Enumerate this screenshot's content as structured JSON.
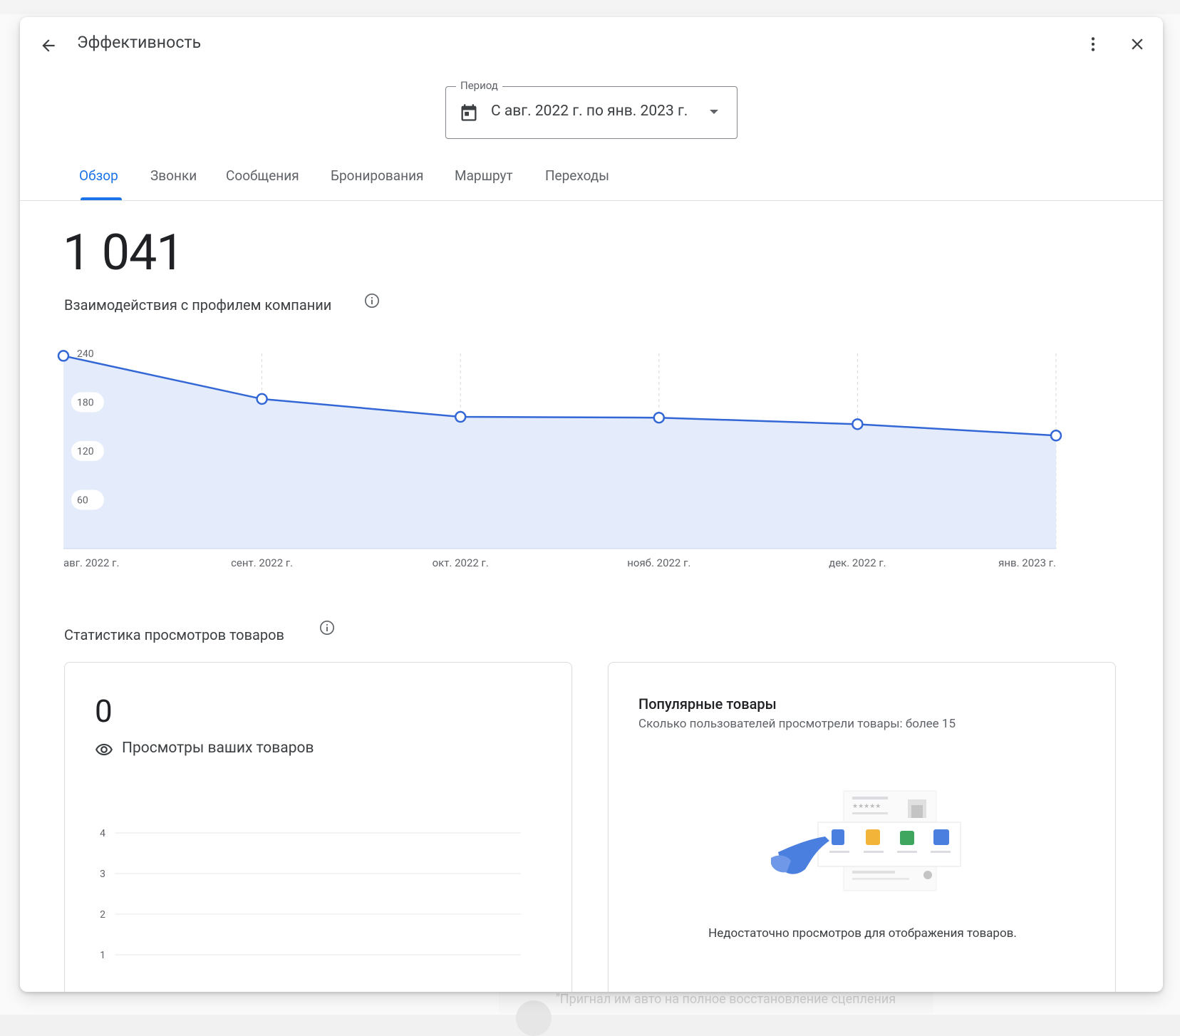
{
  "dialog": {
    "title": "Эффективность"
  },
  "period": {
    "label": "Период",
    "value": "С авг. 2022 г. по янв. 2023 г."
  },
  "tabs": [
    {
      "label": "Обзор",
      "active": true
    },
    {
      "label": "Звонки",
      "active": false
    },
    {
      "label": "Сообщения",
      "active": false
    },
    {
      "label": "Бронирования",
      "active": false
    },
    {
      "label": "Маршрут",
      "active": false
    },
    {
      "label": "Переходы",
      "active": false
    }
  ],
  "interactions": {
    "total": "1 041",
    "label": "Взаимодействия с профилем компании"
  },
  "chart_data": {
    "type": "area",
    "categories": [
      "авг. 2022 г.",
      "сент. 2022 г.",
      "окт. 2022 г.",
      "нояб. 2022 г.",
      "дек. 2022 г.",
      "янв. 2023 г."
    ],
    "series": [
      {
        "values": [
          237,
          184,
          162,
          161,
          153,
          139
        ]
      }
    ],
    "yticks": [
      60,
      120,
      180,
      240
    ],
    "ylim": [
      0,
      240
    ],
    "grid": "vertical dashed",
    "line_color": "#3367d6",
    "fill_color": "#e4ebfa"
  },
  "product_stats": {
    "title": "Статистика просмотров товаров",
    "views": {
      "value": "0",
      "label": "Просмотры ваших товаров",
      "axis_ticks": [
        "4",
        "3",
        "2",
        "1"
      ]
    },
    "popular": {
      "title": "Популярные товары",
      "subtitle": "Сколько пользователей просмотрели товары: более 15",
      "empty_message": "Недостаточно просмотров для отображения товаров."
    }
  },
  "background": {
    "footer_text": "\"Пригнал им авто на полное восстановление сцепления"
  },
  "colors": {
    "accent": "#1a73e8",
    "line": "#3367d6",
    "area": "#e4ebfa"
  }
}
